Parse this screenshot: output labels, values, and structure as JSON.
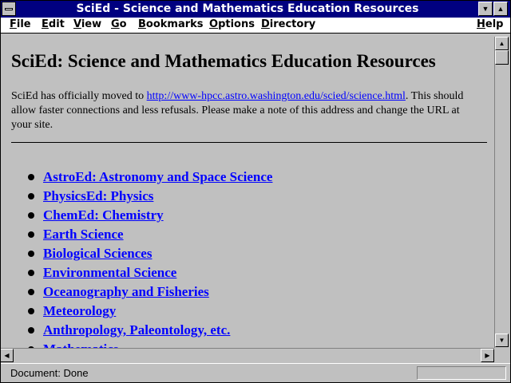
{
  "window": {
    "title": "SciEd - Science and Mathematics Education Resources",
    "system_menu_icon": "system-menu-icon",
    "minimize_icon": "minimize-icon",
    "maximize_icon": "maximize-icon"
  },
  "menubar": {
    "items": [
      {
        "label_u": "F",
        "label_rest": "ile"
      },
      {
        "label_u": "E",
        "label_rest": "dit"
      },
      {
        "label_u": "V",
        "label_rest": "iew"
      },
      {
        "label_u": "G",
        "label_rest": "o"
      },
      {
        "label_u": "B",
        "label_rest": "ookmarks"
      },
      {
        "label_u": "O",
        "label_rest": "ptions"
      },
      {
        "label_u": "D",
        "label_rest": "irectory"
      },
      {
        "label_u": "H",
        "label_rest": "elp"
      }
    ]
  },
  "page": {
    "heading": "SciEd: Science and Mathematics Education Resources",
    "notice_before": "SciEd has officially moved to ",
    "notice_link": "http://www-hpcc.astro.washington.edu/scied/science.html",
    "notice_after": ". This should allow faster connections and less refusals. Please make a note of this address and change the URL at your site.",
    "links": [
      "AstroEd: Astronomy and Space Science",
      "PhysicsEd: Physics",
      "ChemEd: Chemistry",
      "Earth Science",
      "Biological Sciences",
      "Environmental Science",
      "Oceanography and Fisheries",
      "Meteorology",
      "Anthropology, Paleontology, etc.",
      "Mathematics"
    ]
  },
  "status": {
    "text": "Document: Done"
  },
  "colors": {
    "titlebar": "#000080",
    "link": "#0000ff",
    "background": "#c0c0c0"
  }
}
